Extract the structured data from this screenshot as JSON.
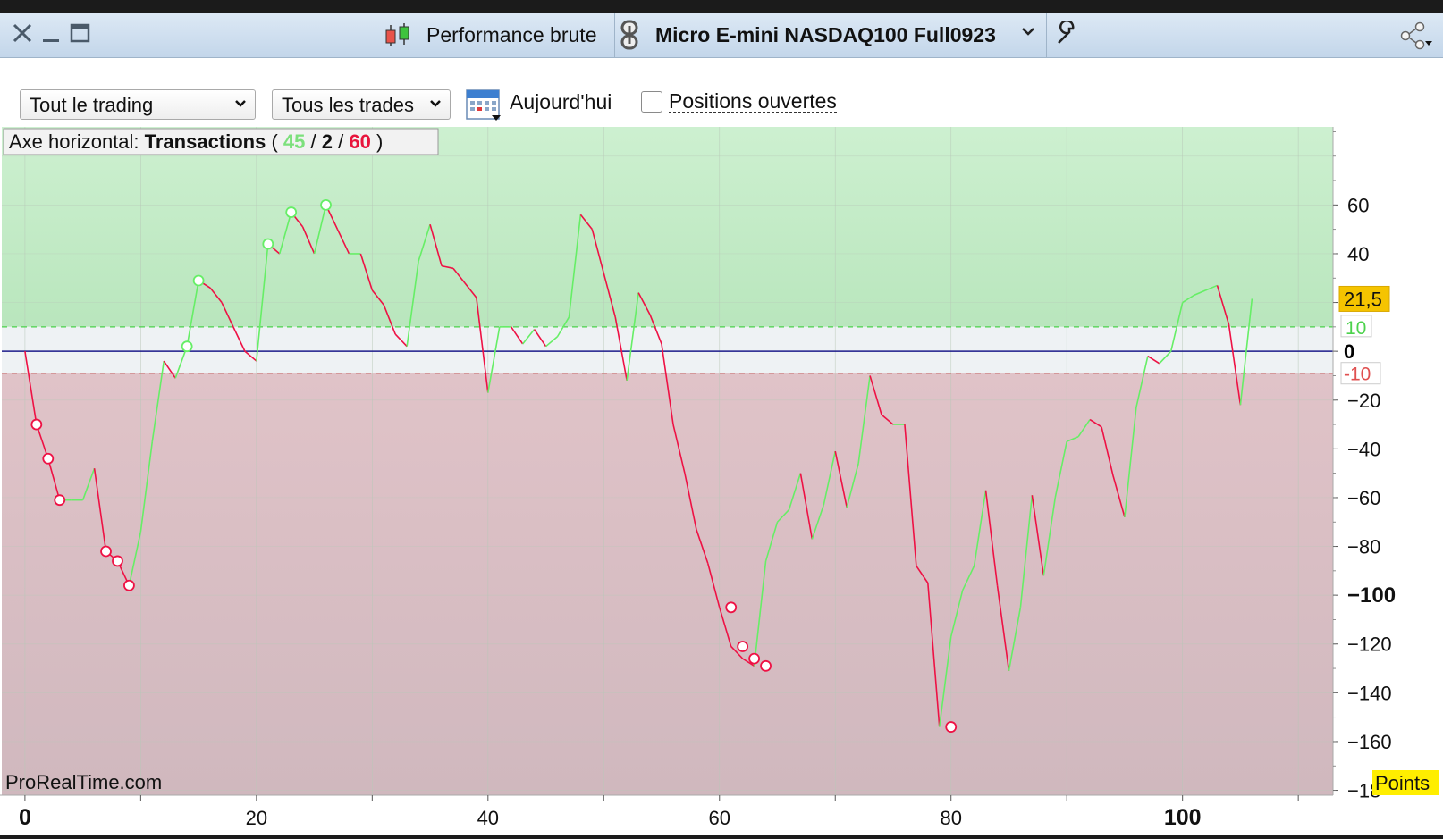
{
  "window": {
    "title": "Performance brute",
    "instrument": "Micro E-mini NASDAQ100 Full0923",
    "close_icon": "close-icon",
    "minimize_icon": "minimize-icon",
    "maximize_icon": "maximize-icon",
    "link_icon": "link-icon",
    "settings_icon": "wrench-icon",
    "share_icon": "share-icon"
  },
  "toolbar": {
    "scope_select": "Tout le trading",
    "trades_select": "Tous les trades",
    "calendar_icon": "calendar-icon",
    "date_label": "Aujourd'hui",
    "open_positions_label": "Positions ouvertes",
    "open_positions_checked": false
  },
  "chart_info": {
    "prefix": "Axe horizontal: ",
    "axis_name": "Transactions",
    "open": " ( ",
    "wins": "45",
    "slash1": " / ",
    "neutral": "2",
    "slash2": " / ",
    "losses": "60",
    "close": " )"
  },
  "watermark": "ProRealTime.com",
  "units_label": "Points",
  "last_value_label": "21,5",
  "colors": {
    "up": "#66ee66",
    "down": "#ee1144",
    "zero_line": "#1b1b8a",
    "upper_band": "#4cd24c",
    "lower_band": "#c0504d",
    "positive_zone": "#c6edc9",
    "negative_zone": "#d9bcc2",
    "last_value_bg": "#f5c400"
  },
  "chart_data": {
    "type": "line",
    "xlim": [
      -2,
      113
    ],
    "ylim": [
      -182,
      92
    ],
    "x_ticks": [
      "0",
      "20",
      "40",
      "60",
      "80",
      "100"
    ],
    "y_ticks": [
      "60",
      "40",
      "20",
      "0",
      "−20",
      "−40",
      "−60",
      "−80",
      "−100",
      "−120",
      "−140",
      "−160",
      "−18"
    ],
    "bands": [
      {
        "label": "10",
        "value": 10
      },
      {
        "label": "-10",
        "value": -9
      }
    ],
    "zero_label": "0",
    "last_value": 21.5,
    "series": [
      {
        "values": [
          0,
          -30,
          -44,
          -61,
          -61,
          -61,
          -48,
          -82,
          -86,
          -96,
          -74,
          -37,
          -4,
          -11,
          2,
          29,
          26,
          20,
          10,
          0,
          -4,
          44,
          40,
          57,
          51,
          40,
          60,
          50,
          40,
          40,
          25,
          19,
          7,
          2,
          37,
          52,
          35,
          34,
          28,
          22,
          -17,
          10,
          10,
          3,
          9,
          2,
          6,
          14,
          56,
          50,
          32,
          14,
          -12,
          24,
          15,
          3,
          -30,
          -50,
          -73,
          -87,
          -105,
          -121,
          -126,
          -129,
          -86,
          -70,
          -65,
          -50,
          -77,
          -63,
          -41,
          -64,
          -46,
          -10,
          -26,
          -30,
          -30,
          -88,
          -95,
          -154,
          -117,
          -98,
          -88,
          -57,
          -96,
          -131,
          -105,
          -59,
          -92,
          -60,
          -37,
          -35,
          -28,
          -31,
          -51,
          -68,
          -23,
          -2,
          -5,
          0,
          20,
          23,
          25,
          27,
          11,
          -22,
          21.5
        ]
      }
    ],
    "markers": [
      {
        "x": 1,
        "y": -30,
        "c": "down"
      },
      {
        "x": 2,
        "y": -44,
        "c": "down"
      },
      {
        "x": 3,
        "y": -61,
        "c": "down"
      },
      {
        "x": 7,
        "y": -82,
        "c": "down"
      },
      {
        "x": 8,
        "y": -86,
        "c": "down"
      },
      {
        "x": 9,
        "y": -96,
        "c": "down"
      },
      {
        "x": 14,
        "y": 2,
        "c": "up"
      },
      {
        "x": 15,
        "y": 29,
        "c": "up"
      },
      {
        "x": 21,
        "y": 44,
        "c": "up"
      },
      {
        "x": 23,
        "y": 57,
        "c": "up"
      },
      {
        "x": 26,
        "y": 60,
        "c": "up"
      },
      {
        "x": 61,
        "y": -105,
        "c": "down"
      },
      {
        "x": 62,
        "y": -121,
        "c": "down"
      },
      {
        "x": 63,
        "y": -126,
        "c": "down"
      },
      {
        "x": 64,
        "y": -129,
        "c": "down"
      },
      {
        "x": 80,
        "y": -154,
        "c": "down"
      }
    ]
  }
}
